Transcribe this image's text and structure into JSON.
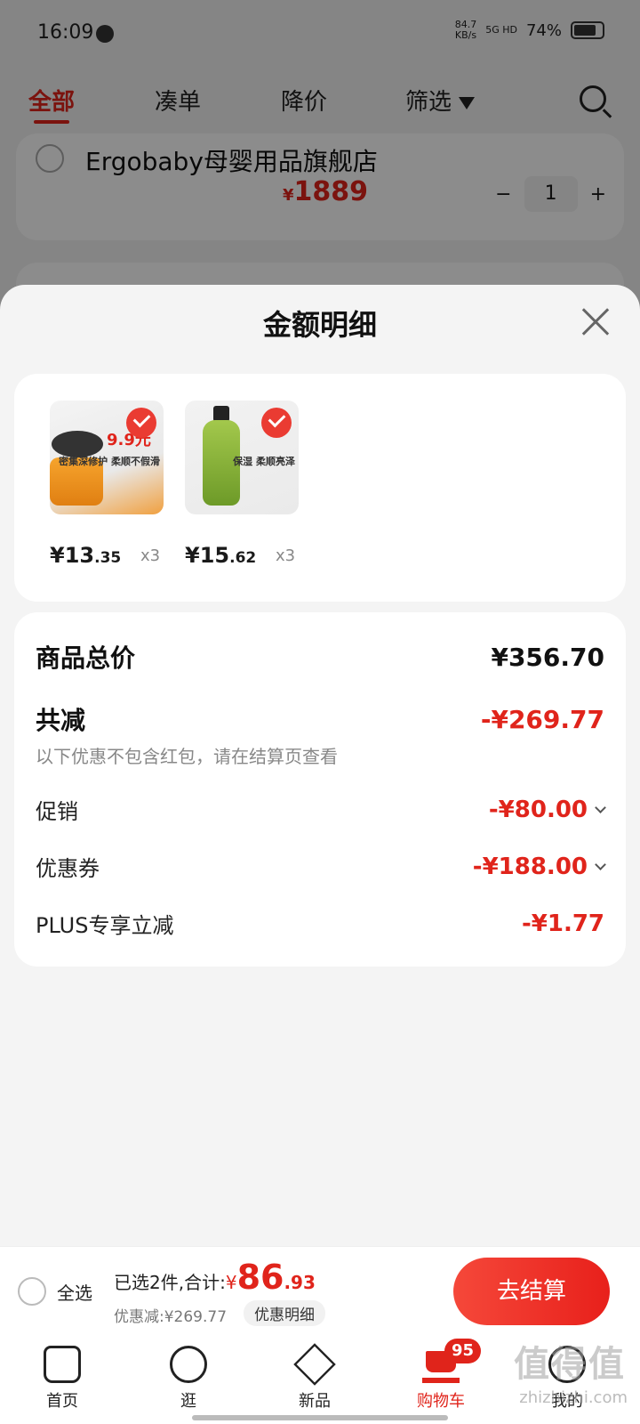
{
  "status_bar": {
    "time": "16:09",
    "network_speed_value": "84.7",
    "network_speed_unit": "KB/s",
    "signal": "5G HD",
    "battery": "74%"
  },
  "tabs": {
    "all": "全部",
    "bundle": "凑单",
    "price_drop": "降价",
    "filter": "筛选"
  },
  "store": {
    "name": "Ergobaby母婴用品旗舰店",
    "price_symbol": "¥",
    "price": "1889",
    "quantity": "1"
  },
  "sheet": {
    "title": "金额明细",
    "items": [
      {
        "price_symbol": "¥",
        "price_int": "13",
        "price_dec": ".35",
        "qty": "x3",
        "promo_price": "9.9元",
        "tagline": "密集深修护 柔顺不假滑"
      },
      {
        "price_symbol": "¥",
        "price_int": "15",
        "price_dec": ".62",
        "qty": "x3",
        "promo_price": "",
        "tagline": "保湿 柔顺亮泽"
      }
    ],
    "summary": {
      "total_label": "商品总价",
      "total_value": "¥356.70",
      "reduce_label": "共减",
      "reduce_value": "-¥269.77",
      "note": "以下优惠不包含红包，请在结算页查看",
      "promo_label": "促销",
      "promo_value": "-¥80.00",
      "coupon_label": "优惠券",
      "coupon_value": "-¥188.00",
      "plus_label": "PLUS专享立减",
      "plus_value": "-¥1.77"
    }
  },
  "checkout": {
    "select_all": "全选",
    "selected_text": "已选2件,合计:",
    "yen": "¥",
    "total_int": "86",
    "total_dec": ".93",
    "discount_text": "优惠减:¥269.77",
    "detail_button": "优惠明细",
    "checkout_button": "去结算"
  },
  "nav": {
    "home": "首页",
    "browse": "逛",
    "new": "新品",
    "cart": "购物车",
    "cart_badge": "95",
    "mine": "我的"
  },
  "watermark": {
    "logo": "值得值",
    "site": "zhizhizhi.com"
  },
  "colors": {
    "accent": "#e0241b",
    "background": "#f4f4f4"
  }
}
